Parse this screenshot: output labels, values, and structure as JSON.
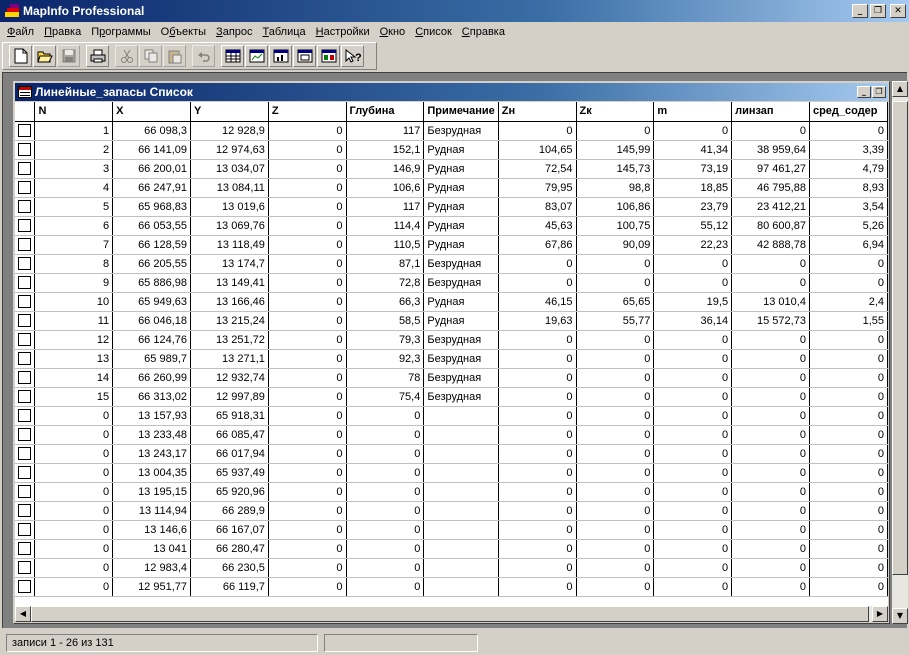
{
  "app": {
    "title": "MapInfo Professional",
    "window_buttons": {
      "minimize": "_",
      "restore": "❐",
      "close": "✕"
    }
  },
  "menu": {
    "items": [
      {
        "label": "Файл",
        "underline": "Ф",
        "rest": "айл"
      },
      {
        "label": "Правка",
        "underline": "П",
        "rest": "равка"
      },
      {
        "label": "Программы",
        "underline": "р",
        "rest": "ограммы",
        "prefix": "П"
      },
      {
        "label": "Объекты",
        "underline": "б",
        "rest": "ъекты",
        "prefix": "О"
      },
      {
        "label": "Запрос",
        "underline": "З",
        "rest": "апрос"
      },
      {
        "label": "Таблица",
        "underline": "Т",
        "rest": "аблица"
      },
      {
        "label": "Настройки",
        "underline": "Н",
        "rest": "астройки"
      },
      {
        "label": "Окно",
        "underline": "О",
        "rest": "кно"
      },
      {
        "label": "Список",
        "underline": "С",
        "rest": "писок"
      },
      {
        "label": "Справка",
        "underline": "С",
        "rest": "правка"
      }
    ]
  },
  "toolbar": {
    "buttons": [
      "new-icon",
      "open-icon",
      "save-icon",
      "print-icon",
      "cut-icon",
      "copy-icon",
      "paste-icon",
      "undo-icon",
      "new-browser-icon",
      "new-mapper-icon",
      "new-grapher-icon",
      "new-layout-icon",
      "new-redistrict-icon",
      "help-pointer-icon"
    ]
  },
  "browser": {
    "title": "Линейные_запасы Список",
    "columns": [
      "N",
      "X",
      "Y",
      "Z",
      "Глубина",
      "Примечание",
      "Zн",
      "Zк",
      "m",
      "линзап",
      "сред_содер"
    ],
    "rows": [
      [
        "1",
        "66 098,3",
        "12 928,9",
        "0",
        "117",
        "Безрудная",
        "0",
        "0",
        "0",
        "0",
        "0"
      ],
      [
        "2",
        "66 141,09",
        "12 974,63",
        "0",
        "152,1",
        "Рудная",
        "104,65",
        "145,99",
        "41,34",
        "38 959,64",
        "3,39"
      ],
      [
        "3",
        "66 200,01",
        "13 034,07",
        "0",
        "146,9",
        "Рудная",
        "72,54",
        "145,73",
        "73,19",
        "97 461,27",
        "4,79"
      ],
      [
        "4",
        "66 247,91",
        "13 084,11",
        "0",
        "106,6",
        "Рудная",
        "79,95",
        "98,8",
        "18,85",
        "46 795,88",
        "8,93"
      ],
      [
        "5",
        "65 968,83",
        "13 019,6",
        "0",
        "117",
        "Рудная",
        "83,07",
        "106,86",
        "23,79",
        "23 412,21",
        "3,54"
      ],
      [
        "6",
        "66 053,55",
        "13 069,76",
        "0",
        "114,4",
        "Рудная",
        "45,63",
        "100,75",
        "55,12",
        "80 600,87",
        "5,26"
      ],
      [
        "7",
        "66 128,59",
        "13 118,49",
        "0",
        "110,5",
        "Рудная",
        "67,86",
        "90,09",
        "22,23",
        "42 888,78",
        "6,94"
      ],
      [
        "8",
        "66 205,55",
        "13 174,7",
        "0",
        "87,1",
        "Безрудная",
        "0",
        "0",
        "0",
        "0",
        "0"
      ],
      [
        "9",
        "65 886,98",
        "13 149,41",
        "0",
        "72,8",
        "Безрудная",
        "0",
        "0",
        "0",
        "0",
        "0"
      ],
      [
        "10",
        "65 949,63",
        "13 166,46",
        "0",
        "66,3",
        "Рудная",
        "46,15",
        "65,65",
        "19,5",
        "13 010,4",
        "2,4"
      ],
      [
        "11",
        "66 046,18",
        "13 215,24",
        "0",
        "58,5",
        "Рудная",
        "19,63",
        "55,77",
        "36,14",
        "15 572,73",
        "1,55"
      ],
      [
        "12",
        "66 124,76",
        "13 251,72",
        "0",
        "79,3",
        "Безрудная",
        "0",
        "0",
        "0",
        "0",
        "0"
      ],
      [
        "13",
        "65 989,7",
        "13 271,1",
        "0",
        "92,3",
        "Безрудная",
        "0",
        "0",
        "0",
        "0",
        "0"
      ],
      [
        "14",
        "66 260,99",
        "12 932,74",
        "0",
        "78",
        "Безрудная",
        "0",
        "0",
        "0",
        "0",
        "0"
      ],
      [
        "15",
        "66 313,02",
        "12 997,89",
        "0",
        "75,4",
        "Безрудная",
        "0",
        "0",
        "0",
        "0",
        "0"
      ],
      [
        "0",
        "13 157,93",
        "65 918,31",
        "0",
        "0",
        "",
        "0",
        "0",
        "0",
        "0",
        "0"
      ],
      [
        "0",
        "13 233,48",
        "66 085,47",
        "0",
        "0",
        "",
        "0",
        "0",
        "0",
        "0",
        "0"
      ],
      [
        "0",
        "13 243,17",
        "66 017,94",
        "0",
        "0",
        "",
        "0",
        "0",
        "0",
        "0",
        "0"
      ],
      [
        "0",
        "13 004,35",
        "65 937,49",
        "0",
        "0",
        "",
        "0",
        "0",
        "0",
        "0",
        "0"
      ],
      [
        "0",
        "13 195,15",
        "65 920,96",
        "0",
        "0",
        "",
        "0",
        "0",
        "0",
        "0",
        "0"
      ],
      [
        "0",
        "13 114,94",
        "66 289,9",
        "0",
        "0",
        "",
        "0",
        "0",
        "0",
        "0",
        "0"
      ],
      [
        "0",
        "13 146,6",
        "66 167,07",
        "0",
        "0",
        "",
        "0",
        "0",
        "0",
        "0",
        "0"
      ],
      [
        "0",
        "13 041",
        "66 280,47",
        "0",
        "0",
        "",
        "0",
        "0",
        "0",
        "0",
        "0"
      ],
      [
        "0",
        "12 983,4",
        "66 230,5",
        "0",
        "0",
        "",
        "0",
        "0",
        "0",
        "0",
        "0"
      ],
      [
        "0",
        "12 951,77",
        "66 119,7",
        "0",
        "0",
        "",
        "0",
        "0",
        "0",
        "0",
        "0"
      ]
    ]
  },
  "status": {
    "records": "записи 1 - 26 из 131",
    "secondary": ""
  },
  "colors": {
    "title_active_start": "#0a246a",
    "title_active_end": "#a6caf0",
    "face": "#d4d0c8",
    "workspace": "#808080"
  }
}
